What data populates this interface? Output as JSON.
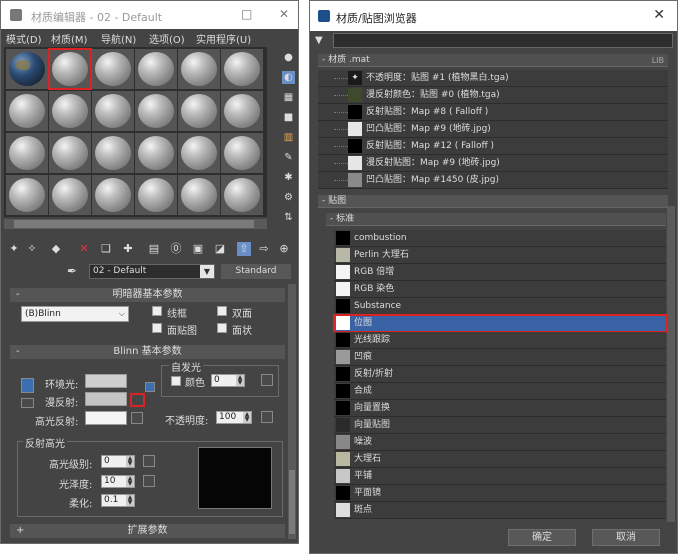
{
  "material_editor": {
    "title": "材质编辑器 - 02 - Default",
    "menu": [
      "模式(D)",
      "材质(M)",
      "导航(N)",
      "选项(O)",
      "实用程序(U)"
    ],
    "material_name": "02 - Default",
    "material_type": "Standard",
    "shader_rollout": {
      "title": "明暗器基本参数",
      "shader": "(B)Blinn",
      "options": [
        "线框",
        "双面",
        "面贴图",
        "面状"
      ]
    },
    "blinn_rollout": {
      "title": "Blinn 基本参数",
      "ambient_label": "环境光:",
      "diffuse_label": "漫反射:",
      "specular_label": "高光反射:",
      "self_illum_title": "自发光",
      "color_label": "颜色",
      "color_value": "0",
      "opacity_label": "不透明度:",
      "opacity_value": "100"
    },
    "highlights": {
      "title": "反射高光",
      "level_label": "高光级别:",
      "level_value": "0",
      "gloss_label": "光泽度:",
      "gloss_value": "10",
      "soften_label": "柔化:",
      "soften_value": "0.1"
    },
    "extended_rollout": "扩展参数"
  },
  "material_browser": {
    "title": "材质/贴图浏览器",
    "scene_section": "- 材质 .mat",
    "scene_section_tag": "LIB",
    "scene_items": [
      "不透明度：贴图 #1 (植物黑白.tga)",
      "漫反射颜色：贴图 #0 (植物.tga)",
      "反射贴图：Map #8 ( Falloff )",
      "凹凸贴图：Map #9 (地砖.jpg)",
      "反射贴图：Map #12 ( Falloff )",
      "漫反射贴图：Map #9 (地砖.jpg)",
      "凹凸贴图：Map #1450 (皮.jpg)"
    ],
    "maps_section": "- 贴图",
    "standard_section": "- 标准",
    "maps": [
      "combustion",
      "Perlin 大理石",
      "RGB 倍增",
      "RGB 染色",
      "Substance",
      "位图",
      "光线跟踪",
      "凹痕",
      "反射/折射",
      "合成",
      "向量置换",
      "向量贴图",
      "噪波",
      "大理石",
      "平铺",
      "平面镜",
      "斑点"
    ],
    "selected_map": "位图",
    "ok_label": "确定",
    "cancel_label": "取消"
  }
}
